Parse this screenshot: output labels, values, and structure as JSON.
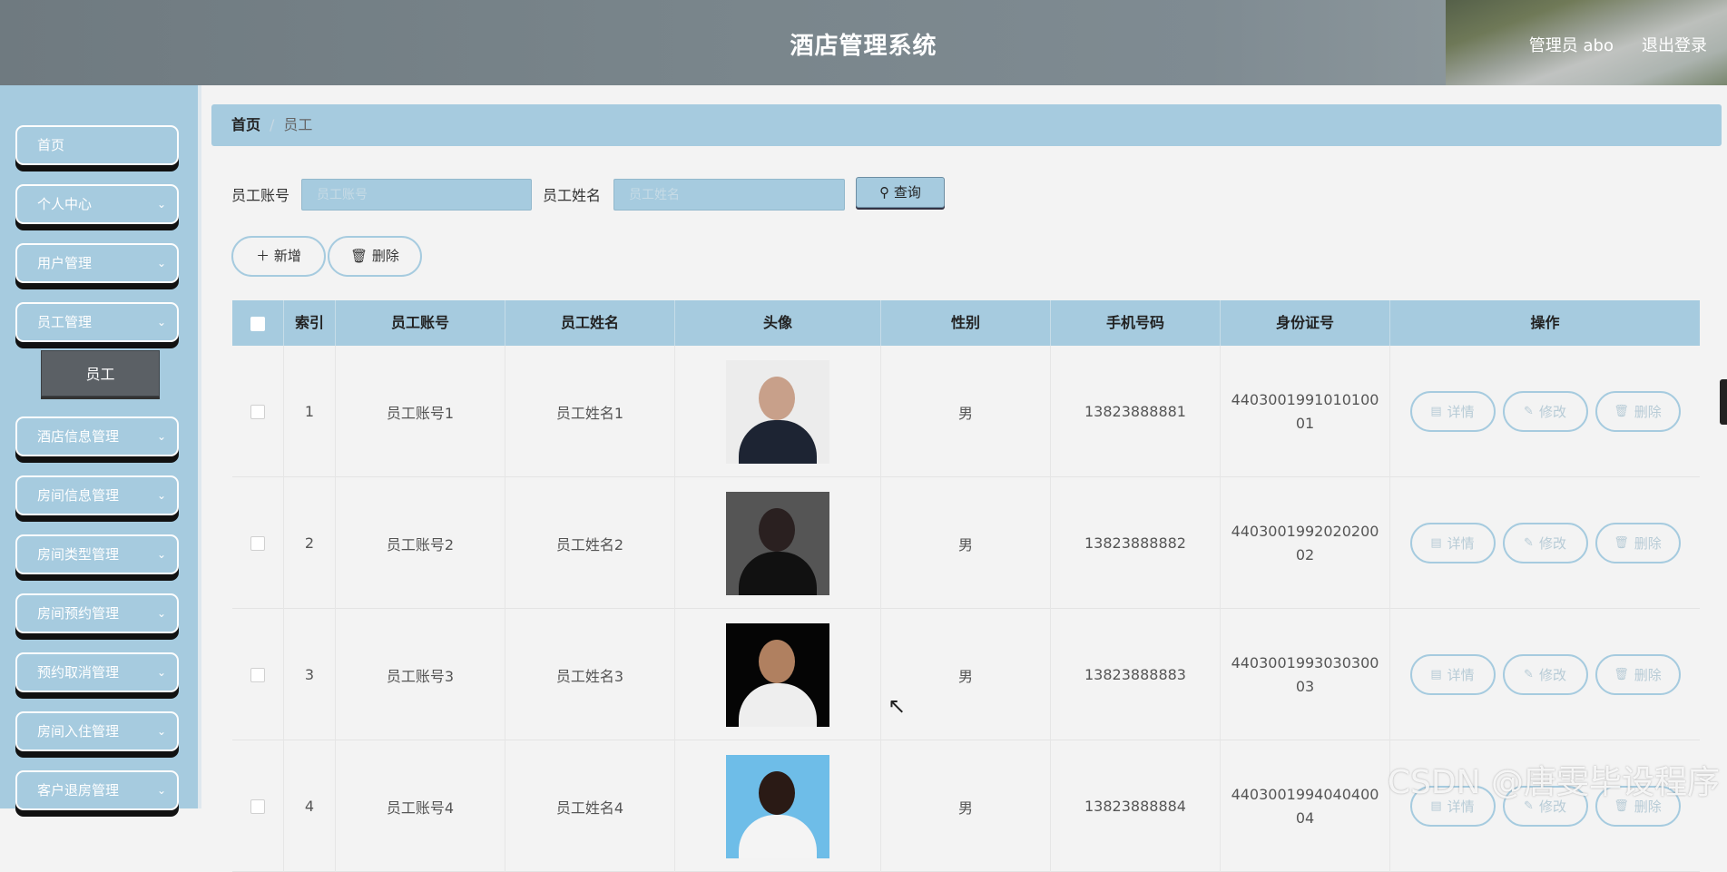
{
  "header": {
    "title": "酒店管理系统",
    "user": "管理员 abo",
    "logout": "退出登录"
  },
  "sidebar": {
    "items": [
      {
        "label": "首页",
        "has_chevron": false
      },
      {
        "label": "个人中心",
        "has_chevron": true
      },
      {
        "label": "用户管理",
        "has_chevron": true
      },
      {
        "label": "员工管理",
        "has_chevron": true
      },
      {
        "label": "酒店信息管理",
        "has_chevron": true
      },
      {
        "label": "房间信息管理",
        "has_chevron": true
      },
      {
        "label": "房间类型管理",
        "has_chevron": true
      },
      {
        "label": "房间预约管理",
        "has_chevron": true
      },
      {
        "label": "预约取消管理",
        "has_chevron": true
      },
      {
        "label": "房间入住管理",
        "has_chevron": true
      },
      {
        "label": "客户退房管理",
        "has_chevron": true
      }
    ],
    "subitem": "员工",
    "chevron_icon": "chevron-down-icon"
  },
  "breadcrumb": {
    "home": "首页",
    "separator": "/",
    "current": "员工"
  },
  "search": {
    "account_label": "员工账号",
    "account_placeholder": "员工账号",
    "name_label": "员工姓名",
    "name_placeholder": "员工姓名",
    "query_label": "查询"
  },
  "actions": {
    "add_label": "新增",
    "delete_label": "删除"
  },
  "table": {
    "headers": [
      "索引",
      "员工账号",
      "员工姓名",
      "头像",
      "性别",
      "手机号码",
      "身份证号",
      "操作"
    ],
    "rows": [
      {
        "index": "1",
        "account": "员工账号1",
        "name": "员工姓名1",
        "gender": "男",
        "phone": "13823888881",
        "idcard": "440300199101010001"
      },
      {
        "index": "2",
        "account": "员工账号2",
        "name": "员工姓名2",
        "gender": "男",
        "phone": "13823888882",
        "idcard": "440300199202020002"
      },
      {
        "index": "3",
        "account": "员工账号3",
        "name": "员工姓名3",
        "gender": "男",
        "phone": "13823888883",
        "idcard": "440300199303030003"
      },
      {
        "index": "4",
        "account": "员工账号4",
        "name": "员工姓名4",
        "gender": "男",
        "phone": "13823888884",
        "idcard": "440300199404040004"
      }
    ],
    "row_actions": {
      "detail": "详情",
      "edit": "修改",
      "delete": "删除"
    }
  },
  "watermark": "CSDN @唐雯毕设程序",
  "colors": {
    "accent": "#a6cbdf",
    "header": "#7a858b",
    "active_submenu": "#5b6065"
  }
}
